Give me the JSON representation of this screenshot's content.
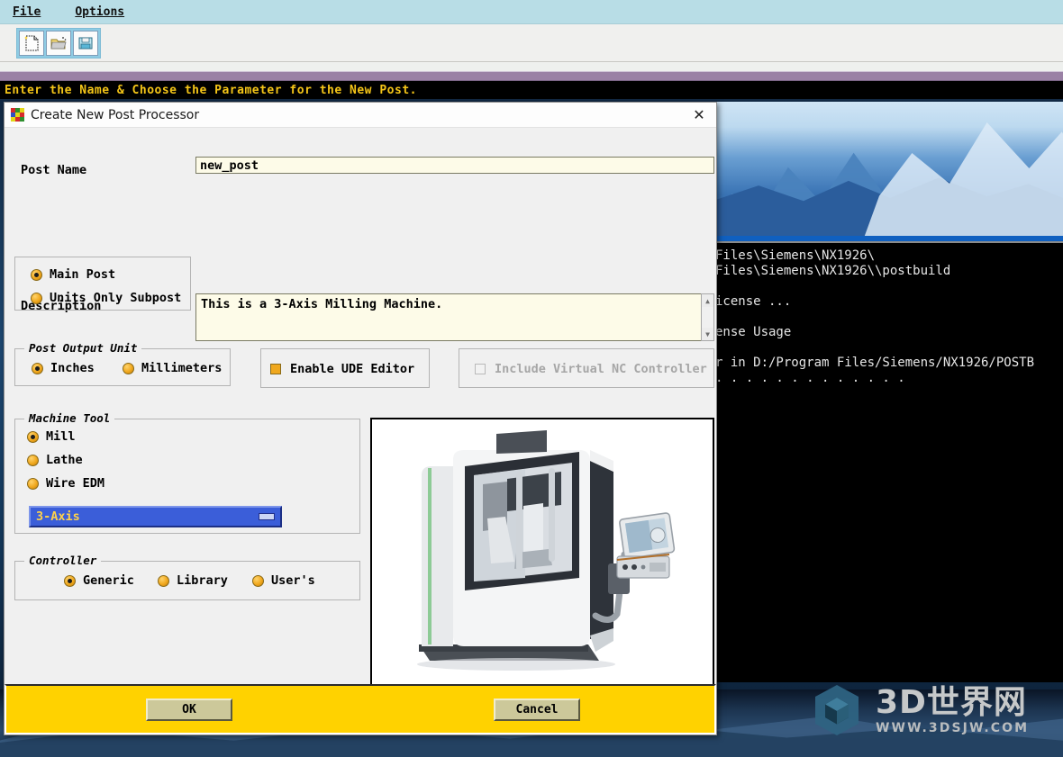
{
  "app": {
    "menu": [
      {
        "label": "File",
        "accel": "F"
      },
      {
        "label": "Options",
        "accel": "O"
      }
    ],
    "toolbar": [
      {
        "name": "new-post-icon",
        "tip": "New"
      },
      {
        "name": "open-post-icon",
        "tip": "Open"
      },
      {
        "name": "save-post-icon",
        "tip": "Save"
      }
    ],
    "status_text": "Enter the Name & Choose the Parameter for the New Post."
  },
  "console": {
    "lines": [
      "Files\\Siemens\\NX1926\\",
      "Files\\Siemens\\NX1926\\\\postbuild",
      "",
      "icense ...",
      "",
      "ense Usage",
      "",
      "r in D:/Program Files/Siemens/NX1926/POSTB",
      ". . . . . . . . . . . . ."
    ]
  },
  "dialog": {
    "title": "Create New Post Processor",
    "close_label": "✕",
    "post_name": {
      "label": "Post Name",
      "value": "new_post"
    },
    "description": {
      "label": "Description",
      "value": "This is a 3-Axis Milling Machine."
    },
    "post_type": {
      "options": [
        "Main Post",
        "Units Only Subpost"
      ],
      "selected": "Main Post"
    },
    "post_output_unit": {
      "legend": "Post Output Unit",
      "options": [
        "Inches",
        "Millimeters"
      ],
      "selected": "Inches"
    },
    "enable_ude_editor": {
      "label": "Enable UDE Editor",
      "checked": true
    },
    "include_virtual_nc": {
      "label": "Include Virtual NC Controller",
      "checked": false,
      "disabled": true
    },
    "machine_tool": {
      "legend": "Machine Tool",
      "options": [
        "Mill",
        "Lathe",
        "Wire EDM"
      ],
      "selected": "Mill",
      "axis_combo": {
        "value": "3-Axis"
      }
    },
    "controller": {
      "legend": "Controller",
      "options": [
        "Generic",
        "Library",
        "User's"
      ],
      "selected": "Generic"
    },
    "machine_preview": {
      "alt": "3-Axis CNC Milling Machine photo"
    },
    "buttons": {
      "ok": "OK",
      "cancel": "Cancel"
    }
  },
  "watermark": {
    "main": "3D世界网",
    "sub": "WWW.3DSJW.COM"
  },
  "colors": {
    "menubar": "#b8dde6",
    "status_fg": "#f4c518",
    "bottom_bar": "#ffd200",
    "combo_sel": "#3b5ed9",
    "combo_text": "#ffd24a",
    "radio": "#f0a81e",
    "field_bg": "#fdfbe8"
  }
}
